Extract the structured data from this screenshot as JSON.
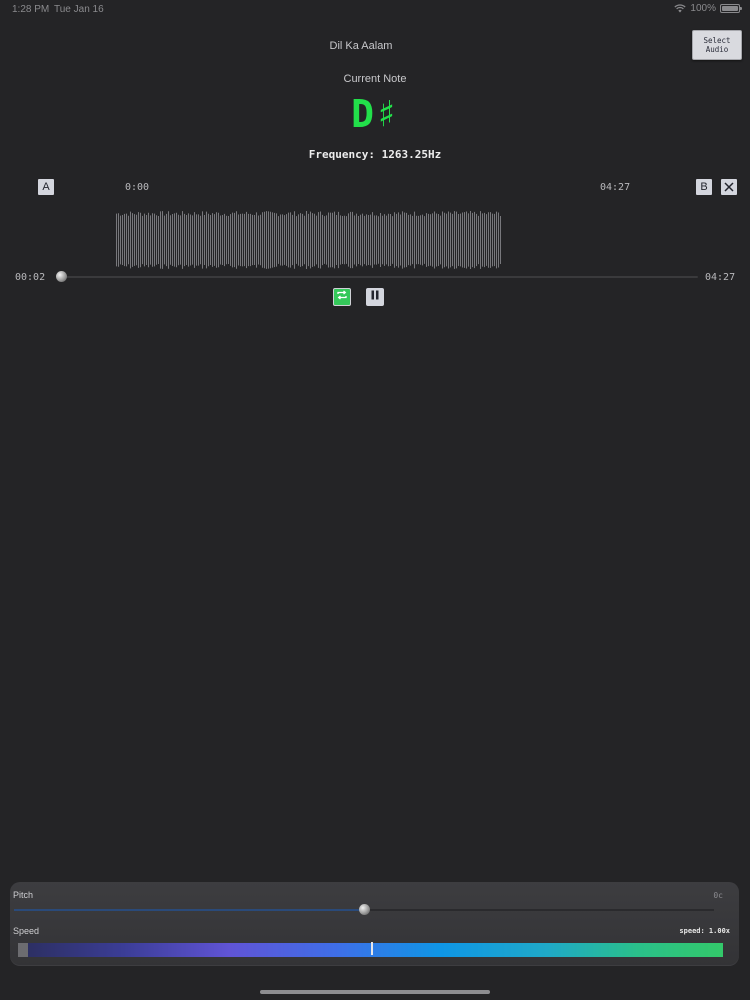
{
  "status_bar": {
    "time": "1:28 PM",
    "date": "Tue Jan 16",
    "battery": "100%"
  },
  "header": {
    "song_title": "Dil Ka Aalam",
    "select_audio_label": "Select Audio"
  },
  "tuner": {
    "current_note_label": "Current Note",
    "note": "D♯",
    "frequency_text": "Frequency: 1263.25Hz"
  },
  "loop": {
    "marker_a_label": "A",
    "marker_b_label": "B",
    "start_time": "0:00",
    "end_time": "04:27"
  },
  "player": {
    "current_time": "00:02",
    "total_time": "04:27",
    "progress_fraction": 0.004
  },
  "adjustments": {
    "pitch_label": "Pitch",
    "pitch_value": "0c",
    "pitch_fraction": 0.5,
    "speed_label": "Speed",
    "speed_value": "speed: 1.00x",
    "speed_fraction": 0.5
  },
  "colors": {
    "background": "#242426",
    "note_green": "#22e04a",
    "repeat_active": "#35c85a"
  },
  "icons": {
    "repeat": "repeat-icon",
    "pause": "pause-icon",
    "clear": "close-icon"
  }
}
